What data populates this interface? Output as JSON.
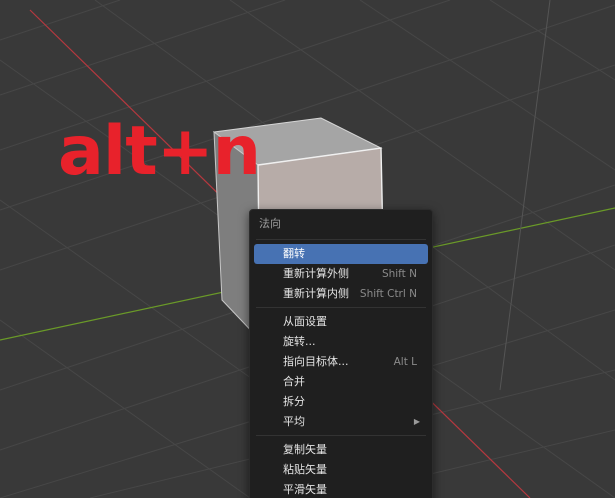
{
  "overlay": {
    "text": "alt+n"
  },
  "menu": {
    "title": "法向",
    "groups": [
      [
        {
          "label": "翻转",
          "shortcut": "",
          "active": true
        },
        {
          "label": "重新计算外侧",
          "shortcut": "Shift N"
        },
        {
          "label": "重新计算内侧",
          "shortcut": "Shift Ctrl N"
        }
      ],
      [
        {
          "label": "从面设置",
          "shortcut": ""
        },
        {
          "label": "旋转...",
          "shortcut": ""
        },
        {
          "label": "指向目标体...",
          "shortcut": "Alt L"
        },
        {
          "label": "合并",
          "shortcut": ""
        },
        {
          "label": "拆分",
          "shortcut": ""
        },
        {
          "label": "平均",
          "shortcut": "",
          "submenu": true
        }
      ],
      [
        {
          "label": "复制矢量",
          "shortcut": ""
        },
        {
          "label": "粘贴矢量",
          "shortcut": ""
        },
        {
          "label": "平滑矢量",
          "shortcut": ""
        }
      ]
    ]
  },
  "colors": {
    "viewport_bg": "#393939",
    "grid": "#444444",
    "x_axis": "#b5383f",
    "y_axis": "#6a9a28",
    "active_item": "#4772b3",
    "overlay_text": "#e8222b"
  },
  "icons": {
    "submenu_arrow": "▶"
  }
}
